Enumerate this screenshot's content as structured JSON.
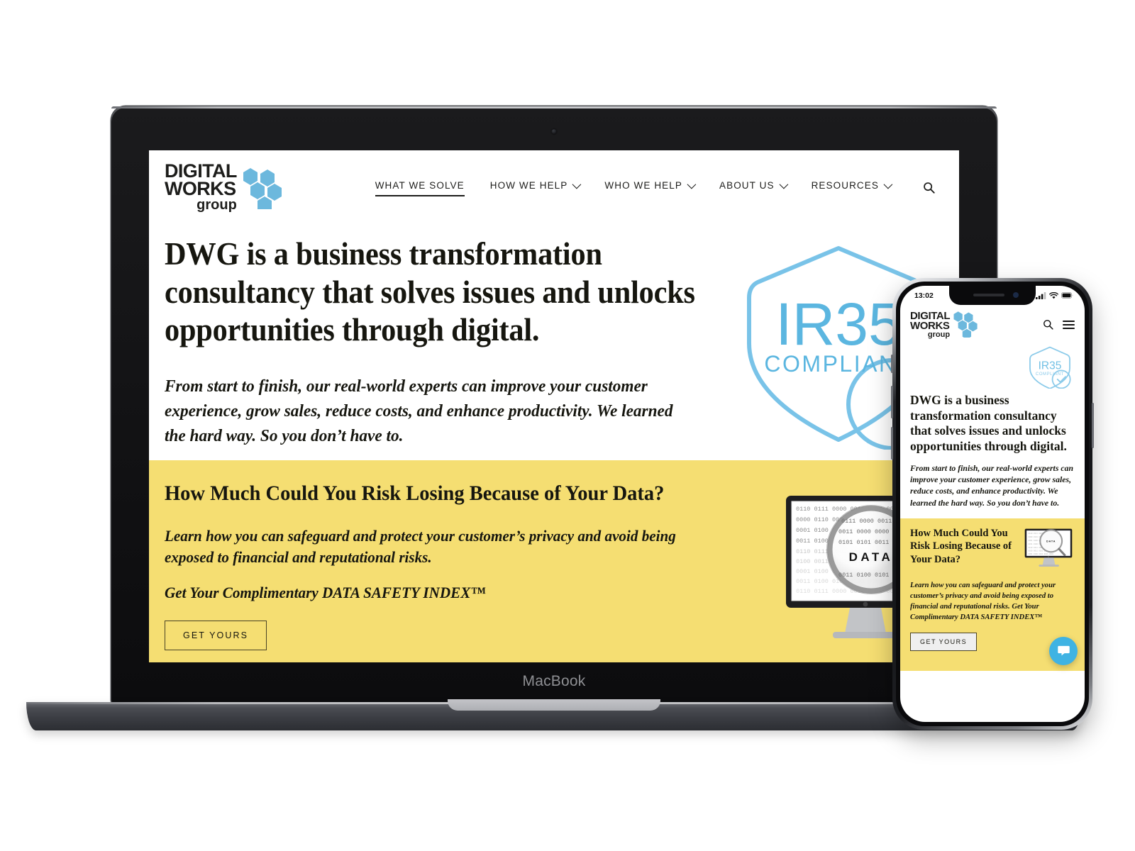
{
  "device_labels": {
    "macbook": "MacBook"
  },
  "brand": {
    "line1": "DIGITAL",
    "line2": "WORKS",
    "line3": "group",
    "hex_color": "#6cb8dd",
    "accent_yellow": "#f5de72",
    "text_dark": "#16160f"
  },
  "desktop": {
    "nav": {
      "items": [
        {
          "label": "WHAT WE SOLVE",
          "has_dropdown": false,
          "active": true
        },
        {
          "label": "HOW WE HELP",
          "has_dropdown": true,
          "active": false
        },
        {
          "label": "WHO WE HELP",
          "has_dropdown": true,
          "active": false
        },
        {
          "label": "ABOUT US",
          "has_dropdown": true,
          "active": false
        },
        {
          "label": "RESOURCES",
          "has_dropdown": true,
          "active": false
        }
      ],
      "search_icon": "search-icon"
    },
    "hero": {
      "title": "DWG is a business transformation consultancy that solves issues and unlocks opportunities through digital.",
      "subtitle": "From start to finish, our real-world experts can improve your customer experience, grow sales, reduce costs, and enhance productivity. We learned the hard way. So you don’t have to.",
      "badge": {
        "line1": "IR35",
        "line2": "COMPLIANT"
      }
    },
    "cta_band": {
      "title": "How Much Could You Risk Losing Because of Your Data?",
      "paragraph": "Learn how you can safeguard and protect your customer’s privacy and avoid being exposed to financial and reputational risks.",
      "offer": "Get Your Complimentary DATA SAFETY INDEX™",
      "button_label": "GET YOURS",
      "artwork": {
        "screen_word": "DATA",
        "icon": "imac-data-magnifier-illustration"
      }
    }
  },
  "mobile": {
    "status_bar": {
      "time": "13:02",
      "icons": [
        "signal-icon",
        "wifi-icon",
        "battery-icon"
      ]
    },
    "header": {
      "search_icon": "search-icon",
      "menu_icon": "hamburger-menu-icon"
    },
    "badge": {
      "line1": "IR35",
      "line2": "COMPLIANT"
    },
    "hero": {
      "title": "DWG is a business transformation consultancy that solves issues and unlocks opportunities through digital.",
      "subtitle": "From start to finish, our real-world experts can improve your customer experience, grow sales, reduce costs, and enhance productivity. We learned the hard way. So you don’t have to."
    },
    "cta_band": {
      "title": "How Much Could You Risk Losing Because of Your Data?",
      "paragraph": "Learn how you can safeguard and protect your customer’s privacy and avoid being exposed to financial and reputational risks. Get Your Complimentary DATA SAFETY INDEX™",
      "button_label": "GET YOURS",
      "artwork": {
        "screen_word": "DATA",
        "icon": "imac-data-magnifier-illustration"
      }
    },
    "chat_widget": {
      "icon": "chat-bubble-icon",
      "color": "#3fb3e3"
    }
  }
}
